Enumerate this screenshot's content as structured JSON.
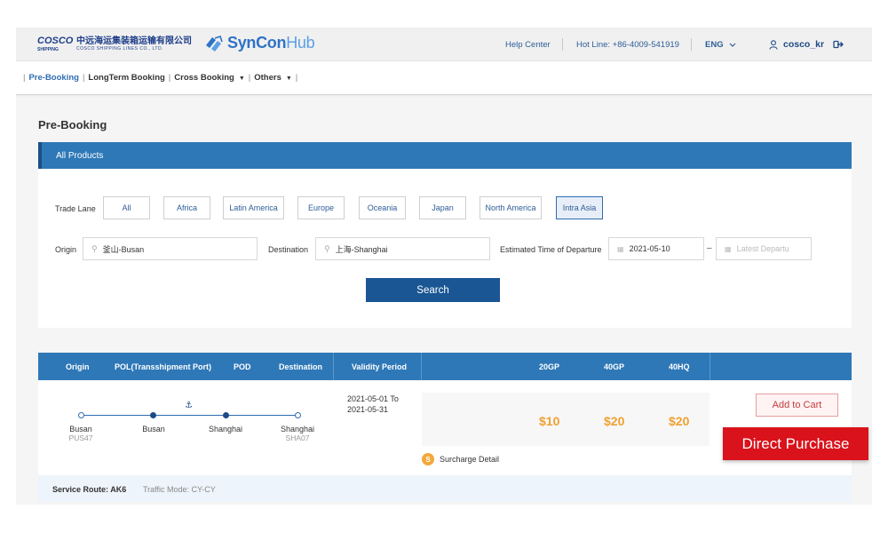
{
  "header": {
    "cosco_word": "COSCO",
    "cosco_sub": "SHIPPING",
    "cosco_cn": "中远海运集装箱运输有限公司",
    "cosco_en": "COSCO SHIPPING LINES CO., LTD.",
    "syncon_main": "SynCon",
    "syncon_hub": "Hub",
    "help_center": "Help Center",
    "hot_line": "Hot Line:  +86-4009-541919",
    "language": "ENG",
    "username": "cosco_kr"
  },
  "nav": {
    "items": [
      "Pre-Booking",
      "LongTerm Booking",
      "Cross Booking",
      "Others"
    ]
  },
  "page": {
    "title": "Pre-Booking"
  },
  "products": {
    "panel_title": "All Products",
    "trade_lane_label": "Trade Lane",
    "lanes": [
      "All",
      "Africa",
      "Latin America",
      "Europe",
      "Oceania",
      "Japan",
      "North America",
      "Intra Asia"
    ],
    "selected_lane": "Intra Asia",
    "origin_label": "Origin",
    "origin_value": "釜山-Busan",
    "destination_label": "Destination",
    "destination_value": "上海-Shanghai",
    "etd_label": "Estimated Time of Departure",
    "etd_value": "2021-05-10",
    "latest_placeholder": "Latest Departu",
    "search_label": "Search"
  },
  "table": {
    "headers": [
      "Origin",
      "POL(Transshipment Port)",
      "POD",
      "Destination",
      "Validity Period",
      "20GP",
      "40GP",
      "40HQ"
    ]
  },
  "result": {
    "stops": [
      {
        "name": "Busan",
        "code": "PUS47"
      },
      {
        "name": "Busan",
        "code": ""
      },
      {
        "name": "Shanghai",
        "code": ""
      },
      {
        "name": "Shanghai",
        "code": "SHA07"
      }
    ],
    "validity_from": "2021-05-01 To",
    "validity_to": "2021-05-31",
    "prices": [
      "$10",
      "$20",
      "$20"
    ],
    "add_to_cart": "Add to Cart",
    "surcharge_icon": "S",
    "surcharge_detail": "Surcharge Detail",
    "service_route_label": "Service Route:",
    "service_route_value": "AK6",
    "traffic_mode_label": "Traffic Mode:",
    "traffic_mode_value": "CY-CY"
  },
  "overlay": {
    "direct_purchase": "Direct Purchase"
  },
  "colors": {
    "primary_blue": "#2e78b7",
    "dark_blue": "#1a5694",
    "price_orange": "#f0a030",
    "direct_red": "#d9121b"
  }
}
